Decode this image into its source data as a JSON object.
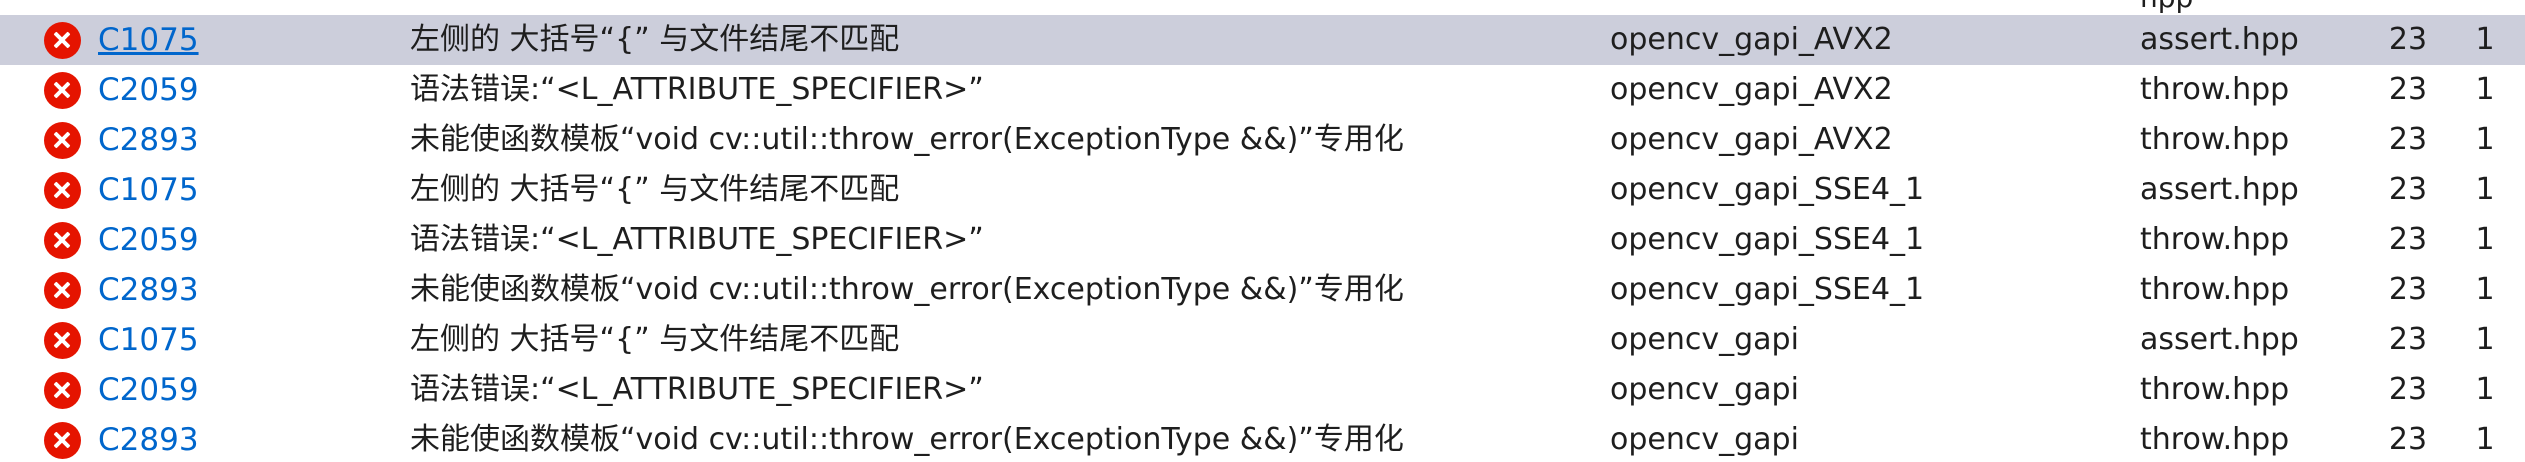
{
  "header": {
    "partial_file_text": "hpp"
  },
  "rows": [
    {
      "code": "C1075",
      "description": "左侧的 大括号“{” 与文件结尾不匹配",
      "project": "opencv_gapi_AVX2",
      "file": "assert.hpp",
      "line": "23",
      "suppression": "1"
    },
    {
      "code": "C2059",
      "description": "语法错误:“<L_ATTRIBUTE_SPECIFIER>”",
      "project": "opencv_gapi_AVX2",
      "file": "throw.hpp",
      "line": "23",
      "suppression": "1"
    },
    {
      "code": "C2893",
      "description": "未能使函数模板“void cv::util::throw_error(ExceptionType &&)”专用化",
      "project": "opencv_gapi_AVX2",
      "file": "throw.hpp",
      "line": "23",
      "suppression": "1"
    },
    {
      "code": "C1075",
      "description": "左侧的 大括号“{” 与文件结尾不匹配",
      "project": "opencv_gapi_SSE4_1",
      "file": "assert.hpp",
      "line": "23",
      "suppression": "1"
    },
    {
      "code": "C2059",
      "description": "语法错误:“<L_ATTRIBUTE_SPECIFIER>”",
      "project": "opencv_gapi_SSE4_1",
      "file": "throw.hpp",
      "line": "23",
      "suppression": "1"
    },
    {
      "code": "C2893",
      "description": "未能使函数模板“void cv::util::throw_error(ExceptionType &&)”专用化",
      "project": "opencv_gapi_SSE4_1",
      "file": "throw.hpp",
      "line": "23",
      "suppression": "1"
    },
    {
      "code": "C1075",
      "description": "左侧的 大括号“{” 与文件结尾不匹配",
      "project": "opencv_gapi",
      "file": "assert.hpp",
      "line": "23",
      "suppression": "1"
    },
    {
      "code": "C2059",
      "description": "语法错误:“<L_ATTRIBUTE_SPECIFIER>”",
      "project": "opencv_gapi",
      "file": "throw.hpp",
      "line": "23",
      "suppression": "1"
    },
    {
      "code": "C2893",
      "description": "未能使函数模板“void cv::util::throw_error(ExceptionType &&)”专用化",
      "project": "opencv_gapi",
      "file": "throw.hpp",
      "line": "23",
      "suppression": "1"
    }
  ],
  "selected_row": 0,
  "icons": {
    "row_icon": "error-icon",
    "icon_color": "#e51400"
  },
  "colors": {
    "selection": "#cccedb",
    "link": "#0066cc"
  }
}
